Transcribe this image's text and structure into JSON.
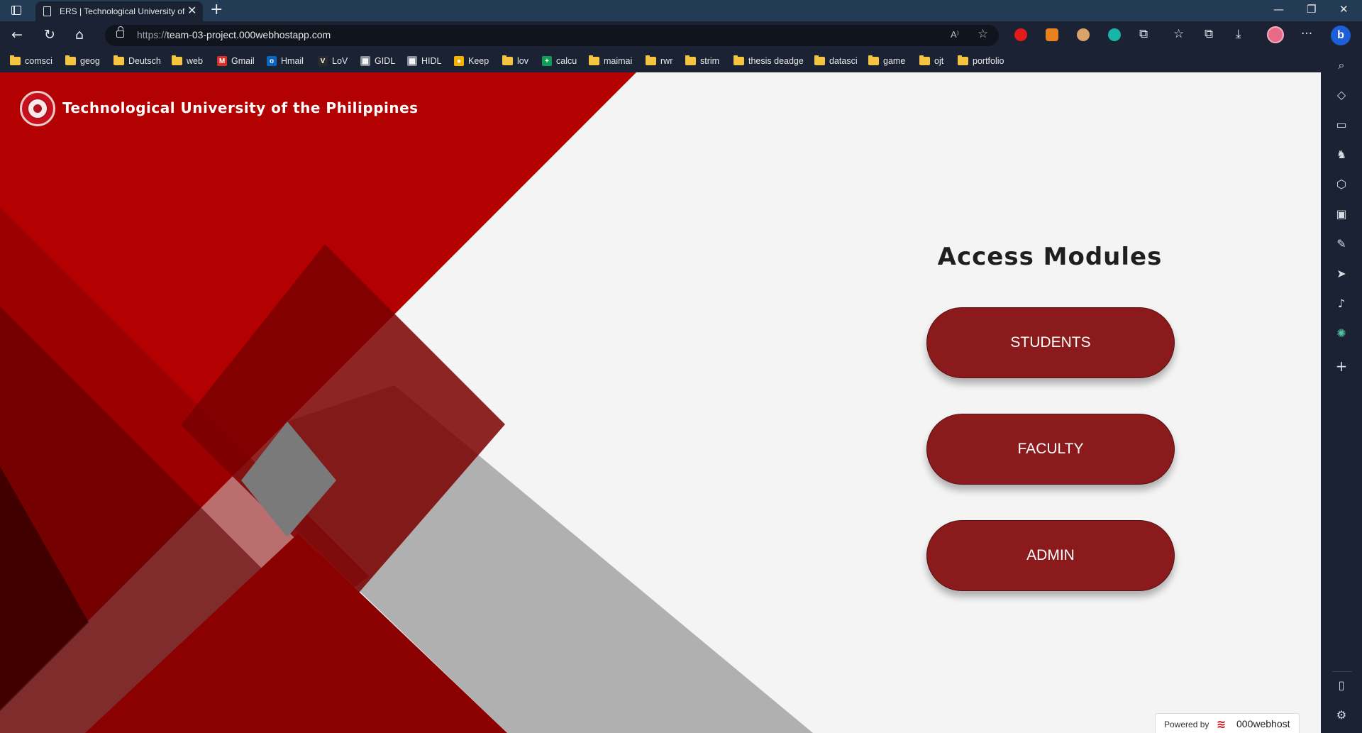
{
  "browser": {
    "tab_title": "ERS | Technological University of",
    "tab_close": "✕",
    "new_tab": "+",
    "window_controls": {
      "minimize": "—",
      "restore": "❐",
      "close": "✕"
    },
    "url_protocol": "https://",
    "url_host": "team-03-project.000webhostapp.com",
    "read_aloud": "A⁾",
    "nav": {
      "back": "←",
      "refresh": "↻",
      "home": "⌂"
    },
    "toolbar_icons": {
      "favorites": "☆",
      "collections": "⧉",
      "downloads": "⤓",
      "more": "···"
    }
  },
  "bookmarks": [
    {
      "label": "comsci",
      "kind": "folder"
    },
    {
      "label": "geog",
      "kind": "folder"
    },
    {
      "label": "Deutsch",
      "kind": "folder"
    },
    {
      "label": "web",
      "kind": "folder"
    },
    {
      "label": "Gmail",
      "kind": "site",
      "glyph": "M",
      "color": "#d93025"
    },
    {
      "label": "Hmail",
      "kind": "site",
      "glyph": "o",
      "color": "#0a66c2"
    },
    {
      "label": "LoV",
      "kind": "site",
      "glyph": "V",
      "color": "#2a2a2a"
    },
    {
      "label": "GIDL",
      "kind": "site",
      "glyph": "▦",
      "color": "#8a8f98"
    },
    {
      "label": "HIDL",
      "kind": "site",
      "glyph": "▦",
      "color": "#8a8f98"
    },
    {
      "label": "Keep",
      "kind": "site",
      "glyph": "●",
      "color": "#f4b400"
    },
    {
      "label": "lov",
      "kind": "folder"
    },
    {
      "label": "calcu",
      "kind": "site",
      "glyph": "+",
      "color": "#0f9d58"
    },
    {
      "label": "maimai",
      "kind": "folder"
    },
    {
      "label": "rwr",
      "kind": "folder"
    },
    {
      "label": "strim",
      "kind": "folder"
    },
    {
      "label": "thesis deadge",
      "kind": "folder"
    },
    {
      "label": "datasci",
      "kind": "folder"
    },
    {
      "label": "game",
      "kind": "folder"
    },
    {
      "label": "ojt",
      "kind": "folder"
    },
    {
      "label": "portfolio",
      "kind": "folder"
    }
  ],
  "page": {
    "site_title": "Technological University of the Philippines",
    "modules_title": "Access Modules",
    "buttons": [
      "STUDENTS",
      "FACULTY",
      "ADMIN"
    ],
    "powered_by": "Powered by",
    "host_name": "000webhost"
  },
  "colors": {
    "accent_red": "#b30000",
    "button_red": "#8b1a1d",
    "page_bg": "#f4f4f4"
  }
}
